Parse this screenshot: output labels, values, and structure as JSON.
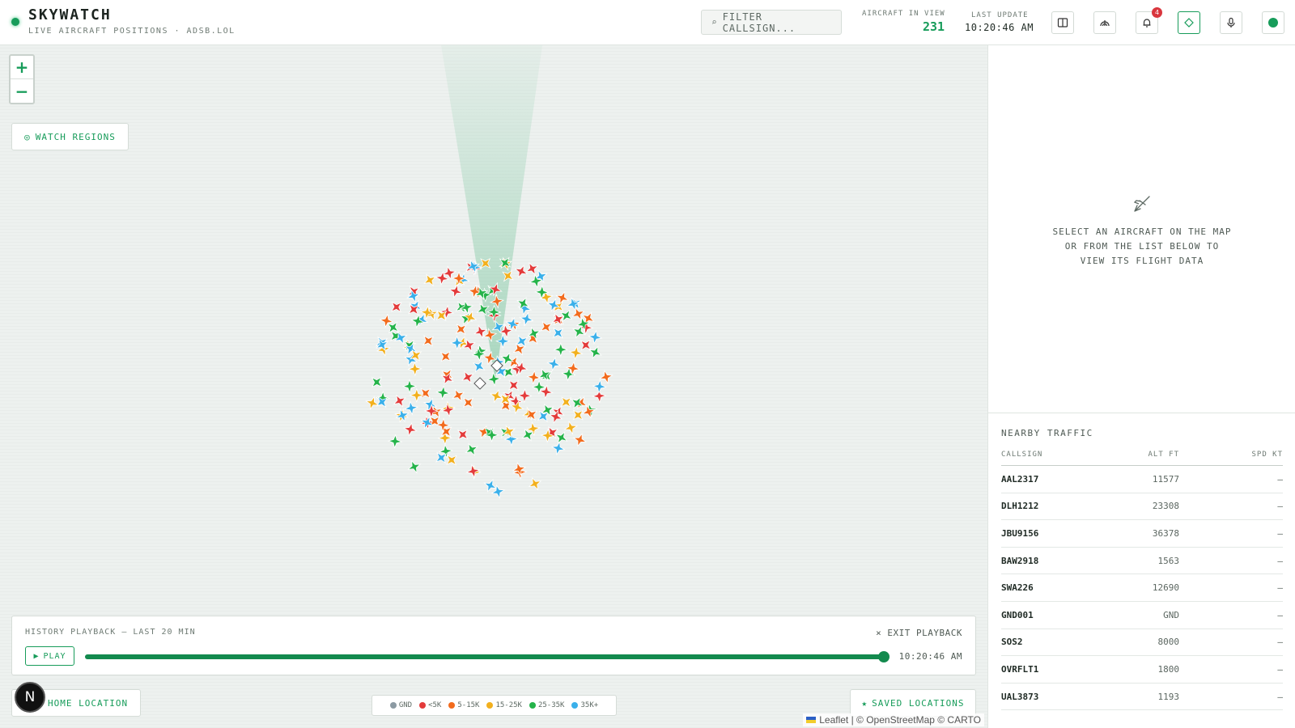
{
  "app": {
    "title": "SKYWATCH",
    "subtitle": "LIVE AIRCRAFT POSITIONS · ADSB.LOL"
  },
  "header": {
    "filter_placeholder": "FILTER CALLSIGN...",
    "aircraft_in_view_label": "AIRCRAFT IN VIEW",
    "aircraft_in_view": "231",
    "last_update_label": "LAST UPDATE",
    "last_update": "10:20:46 AM",
    "notification_count": "4",
    "icons": [
      "panel-icon",
      "radar-icon",
      "bell-icon",
      "diamond-icon",
      "mic-icon",
      "live-status-icon"
    ]
  },
  "map": {
    "zoom_in": "+",
    "zoom_out": "−",
    "watch_regions": "WATCH REGIONS",
    "home_location": "HOME LOCATION",
    "saved_locations": "SAVED LOCATIONS",
    "attribution": "Leaflet | © OpenStreetMap © CARTO",
    "avatar_letter": "N"
  },
  "legend": [
    {
      "label": "GND",
      "color": "#8c9aa3"
    },
    {
      "label": "<5K",
      "color": "#e33b3b"
    },
    {
      "label": "5-15K",
      "color": "#f26b1d"
    },
    {
      "label": "15-25K",
      "color": "#f2b01e"
    },
    {
      "label": "25-35K",
      "color": "#25b34a"
    },
    {
      "label": "35K+",
      "color": "#3ab0ea"
    }
  ],
  "playback": {
    "title": "HISTORY PLAYBACK — LAST 20 MIN",
    "exit": "EXIT PLAYBACK",
    "play": "PLAY",
    "time": "10:20:46 AM",
    "progress": 1.0
  },
  "details": {
    "empty_lines": [
      "SELECT AN AIRCRAFT ON THE MAP",
      "OR FROM THE LIST BELOW TO",
      "VIEW ITS FLIGHT DATA"
    ]
  },
  "traffic": {
    "title": "NEARBY TRAFFIC",
    "columns": [
      "CALLSIGN",
      "ALT FT",
      "SPD KT"
    ],
    "rows": [
      {
        "callsign": "AAL2317",
        "alt": "11577",
        "spd": "—"
      },
      {
        "callsign": "DLH1212",
        "alt": "23308",
        "spd": "—"
      },
      {
        "callsign": "JBU9156",
        "alt": "36378",
        "spd": "—"
      },
      {
        "callsign": "BAW2918",
        "alt": "1563",
        "spd": "—"
      },
      {
        "callsign": "SWA226",
        "alt": "12690",
        "spd": "—"
      },
      {
        "callsign": "GND001",
        "alt": "GND",
        "spd": "—"
      },
      {
        "callsign": "SOS2",
        "alt": "8000",
        "spd": "—"
      },
      {
        "callsign": "OVRFLT1",
        "alt": "1800",
        "spd": "—"
      },
      {
        "callsign": "UAL3873",
        "alt": "1193",
        "spd": "—"
      }
    ]
  }
}
